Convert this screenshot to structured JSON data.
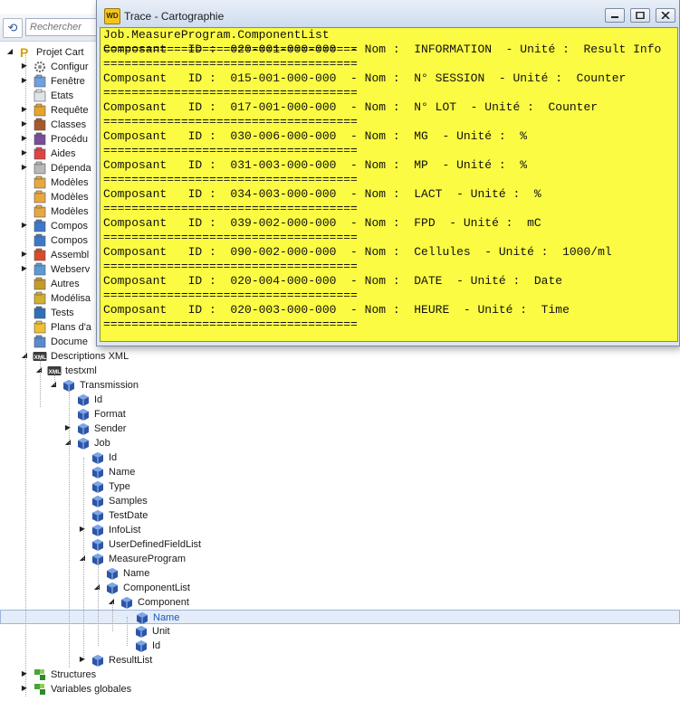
{
  "search": {
    "placeholder": "Rechercher"
  },
  "tree": {
    "root": "Projet Cart",
    "items": [
      {
        "label": "Configur"
      },
      {
        "label": "Fenêtre"
      },
      {
        "label": "Etats"
      },
      {
        "label": "Requête"
      },
      {
        "label": "Classes"
      },
      {
        "label": "Procédu"
      },
      {
        "label": "Aides"
      },
      {
        "label": "Dépenda"
      },
      {
        "label": "Modèles"
      },
      {
        "label": "Modèles"
      },
      {
        "label": "Modèles"
      },
      {
        "label": "Compos"
      },
      {
        "label": "Compos"
      },
      {
        "label": "Assembl"
      },
      {
        "label": "Webserv"
      },
      {
        "label": "Autres"
      },
      {
        "label": "Modélisa"
      },
      {
        "label": "Tests"
      },
      {
        "label": "Plans d'a"
      },
      {
        "label": "Docume"
      }
    ],
    "xml": {
      "descriptions": "Descriptions XML",
      "testxml": "testxml",
      "transmission": "Transmission",
      "trans_children": [
        "Id",
        "Format",
        "Sender",
        "Job"
      ],
      "job_children": [
        "Id",
        "Name",
        "Type",
        "Samples",
        "TestDate",
        "InfoList",
        "UserDefinedFieldList",
        "MeasureProgram"
      ],
      "mp_children": [
        "Name",
        "ComponentList"
      ],
      "component": "Component",
      "comp_children": [
        "Name",
        "Unit",
        "Id"
      ],
      "result_list": "ResultList"
    },
    "structures": "Structures",
    "globals": "Variables globales"
  },
  "trace": {
    "title": "Trace - Cartographie",
    "app_icon": "WD",
    "header": "Job.MeasureProgram.ComponentList",
    "separator": "====================================",
    "lines": [
      "Composant   ID :  020-001-000-000  - Nom :  INFORMATION  - Unité :  Result Info",
      "Composant   ID :  015-001-000-000  - Nom :  N° SESSION  - Unité :  Counter",
      "Composant   ID :  017-001-000-000  - Nom :  N° LOT  - Unité :  Counter",
      "Composant   ID :  030-006-000-000  - Nom :  MG  - Unité :  %",
      "Composant   ID :  031-003-000-000  - Nom :  MP  - Unité :  %",
      "Composant   ID :  034-003-000-000  - Nom :  LACT  - Unité :  %",
      "Composant   ID :  039-002-000-000  - Nom :  FPD  - Unité :  mC",
      "Composant   ID :  090-002-000-000  - Nom :  Cellules  - Unité :  1000/ml",
      "Composant   ID :  020-004-000-000  - Nom :  DATE  - Unité :  Date",
      "Composant   ID :  020-003-000-000  - Nom :  HEURE  - Unité :  Time"
    ]
  },
  "colors": {
    "trace_background": "#fbfb44",
    "selection": "#e3ecf8",
    "selected_text": "#1b55b8"
  }
}
